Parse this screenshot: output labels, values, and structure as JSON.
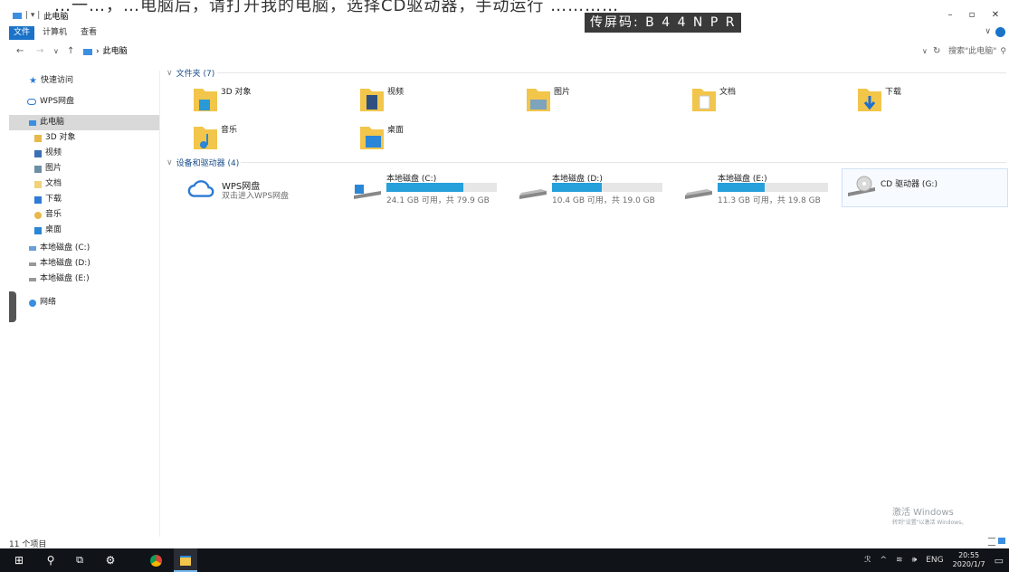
{
  "top_banner": "…一…，…电脑后，请打开我的电脑，选择CD驱动器，手动运行 …………",
  "capture_code": "传屏码: B 4 4 N P R",
  "window_title": "此电脑",
  "ribbon": {
    "tabs": [
      "文件",
      "计算机",
      "查看"
    ]
  },
  "address": {
    "breadcrumb": "此电脑",
    "search_placeholder": "搜索\"此电脑\""
  },
  "sidebar": {
    "items": [
      {
        "label": "快速访问",
        "icon": "star-icon"
      },
      {
        "label": "WPS网盘",
        "icon": "cloud-icon"
      },
      {
        "label": "此电脑",
        "icon": "computer-icon"
      },
      {
        "label": "3D 对象",
        "icon": "3d-objects-icon"
      },
      {
        "label": "视频",
        "icon": "video-icon"
      },
      {
        "label": "图片",
        "icon": "picture-icon"
      },
      {
        "label": "文档",
        "icon": "document-icon"
      },
      {
        "label": "下载",
        "icon": "download-icon"
      },
      {
        "label": "音乐",
        "icon": "music-icon"
      },
      {
        "label": "桌面",
        "icon": "desktop-icon"
      },
      {
        "label": "本地磁盘 (C:)",
        "icon": "disk-icon"
      },
      {
        "label": "本地磁盘 (D:)",
        "icon": "disk-icon"
      },
      {
        "label": "本地磁盘 (E:)",
        "icon": "disk-icon"
      },
      {
        "label": "网络",
        "icon": "network-icon"
      }
    ]
  },
  "sections": {
    "folders_title": "文件夹 (7)",
    "devices_title": "设备和驱动器 (4)"
  },
  "folders": [
    {
      "label": "3D 对象",
      "icon": "3d-objects-folder-icon"
    },
    {
      "label": "视频",
      "icon": "video-folder-icon"
    },
    {
      "label": "图片",
      "icon": "picture-folder-icon"
    },
    {
      "label": "文档",
      "icon": "document-folder-icon"
    },
    {
      "label": "下载",
      "icon": "download-folder-icon"
    },
    {
      "label": "音乐",
      "icon": "music-folder-icon"
    },
    {
      "label": "桌面",
      "icon": "desktop-folder-icon"
    }
  ],
  "wps": {
    "name": "WPS网盘",
    "subtitle": "双击进入WPS网盘"
  },
  "drives": [
    {
      "name": "本地磁盘 (C:)",
      "info": "24.1 GB 可用，共 79.9 GB",
      "used_fraction": 0.7,
      "system": true
    },
    {
      "name": "本地磁盘 (D:)",
      "info": "10.4 GB 可用，共 19.0 GB",
      "used_fraction": 0.45,
      "system": false
    },
    {
      "name": "本地磁盘 (E:)",
      "info": "11.3 GB 可用，共 19.8 GB",
      "used_fraction": 0.43,
      "system": false
    }
  ],
  "cd_drive": {
    "name": "CD 驱动器 (G:)"
  },
  "status": {
    "item_count": "11 个项目"
  },
  "watermark": {
    "line1": "激活 Windows",
    "line2": "转到\"设置\"以激活 Windows。"
  },
  "taskbar": {
    "tray_lang": "ENG",
    "time": "20:55",
    "date": "2020/1/7"
  },
  "colors": {
    "accent": "#1a73c9",
    "progress": "#26a0da",
    "taskbar": "#101317"
  }
}
